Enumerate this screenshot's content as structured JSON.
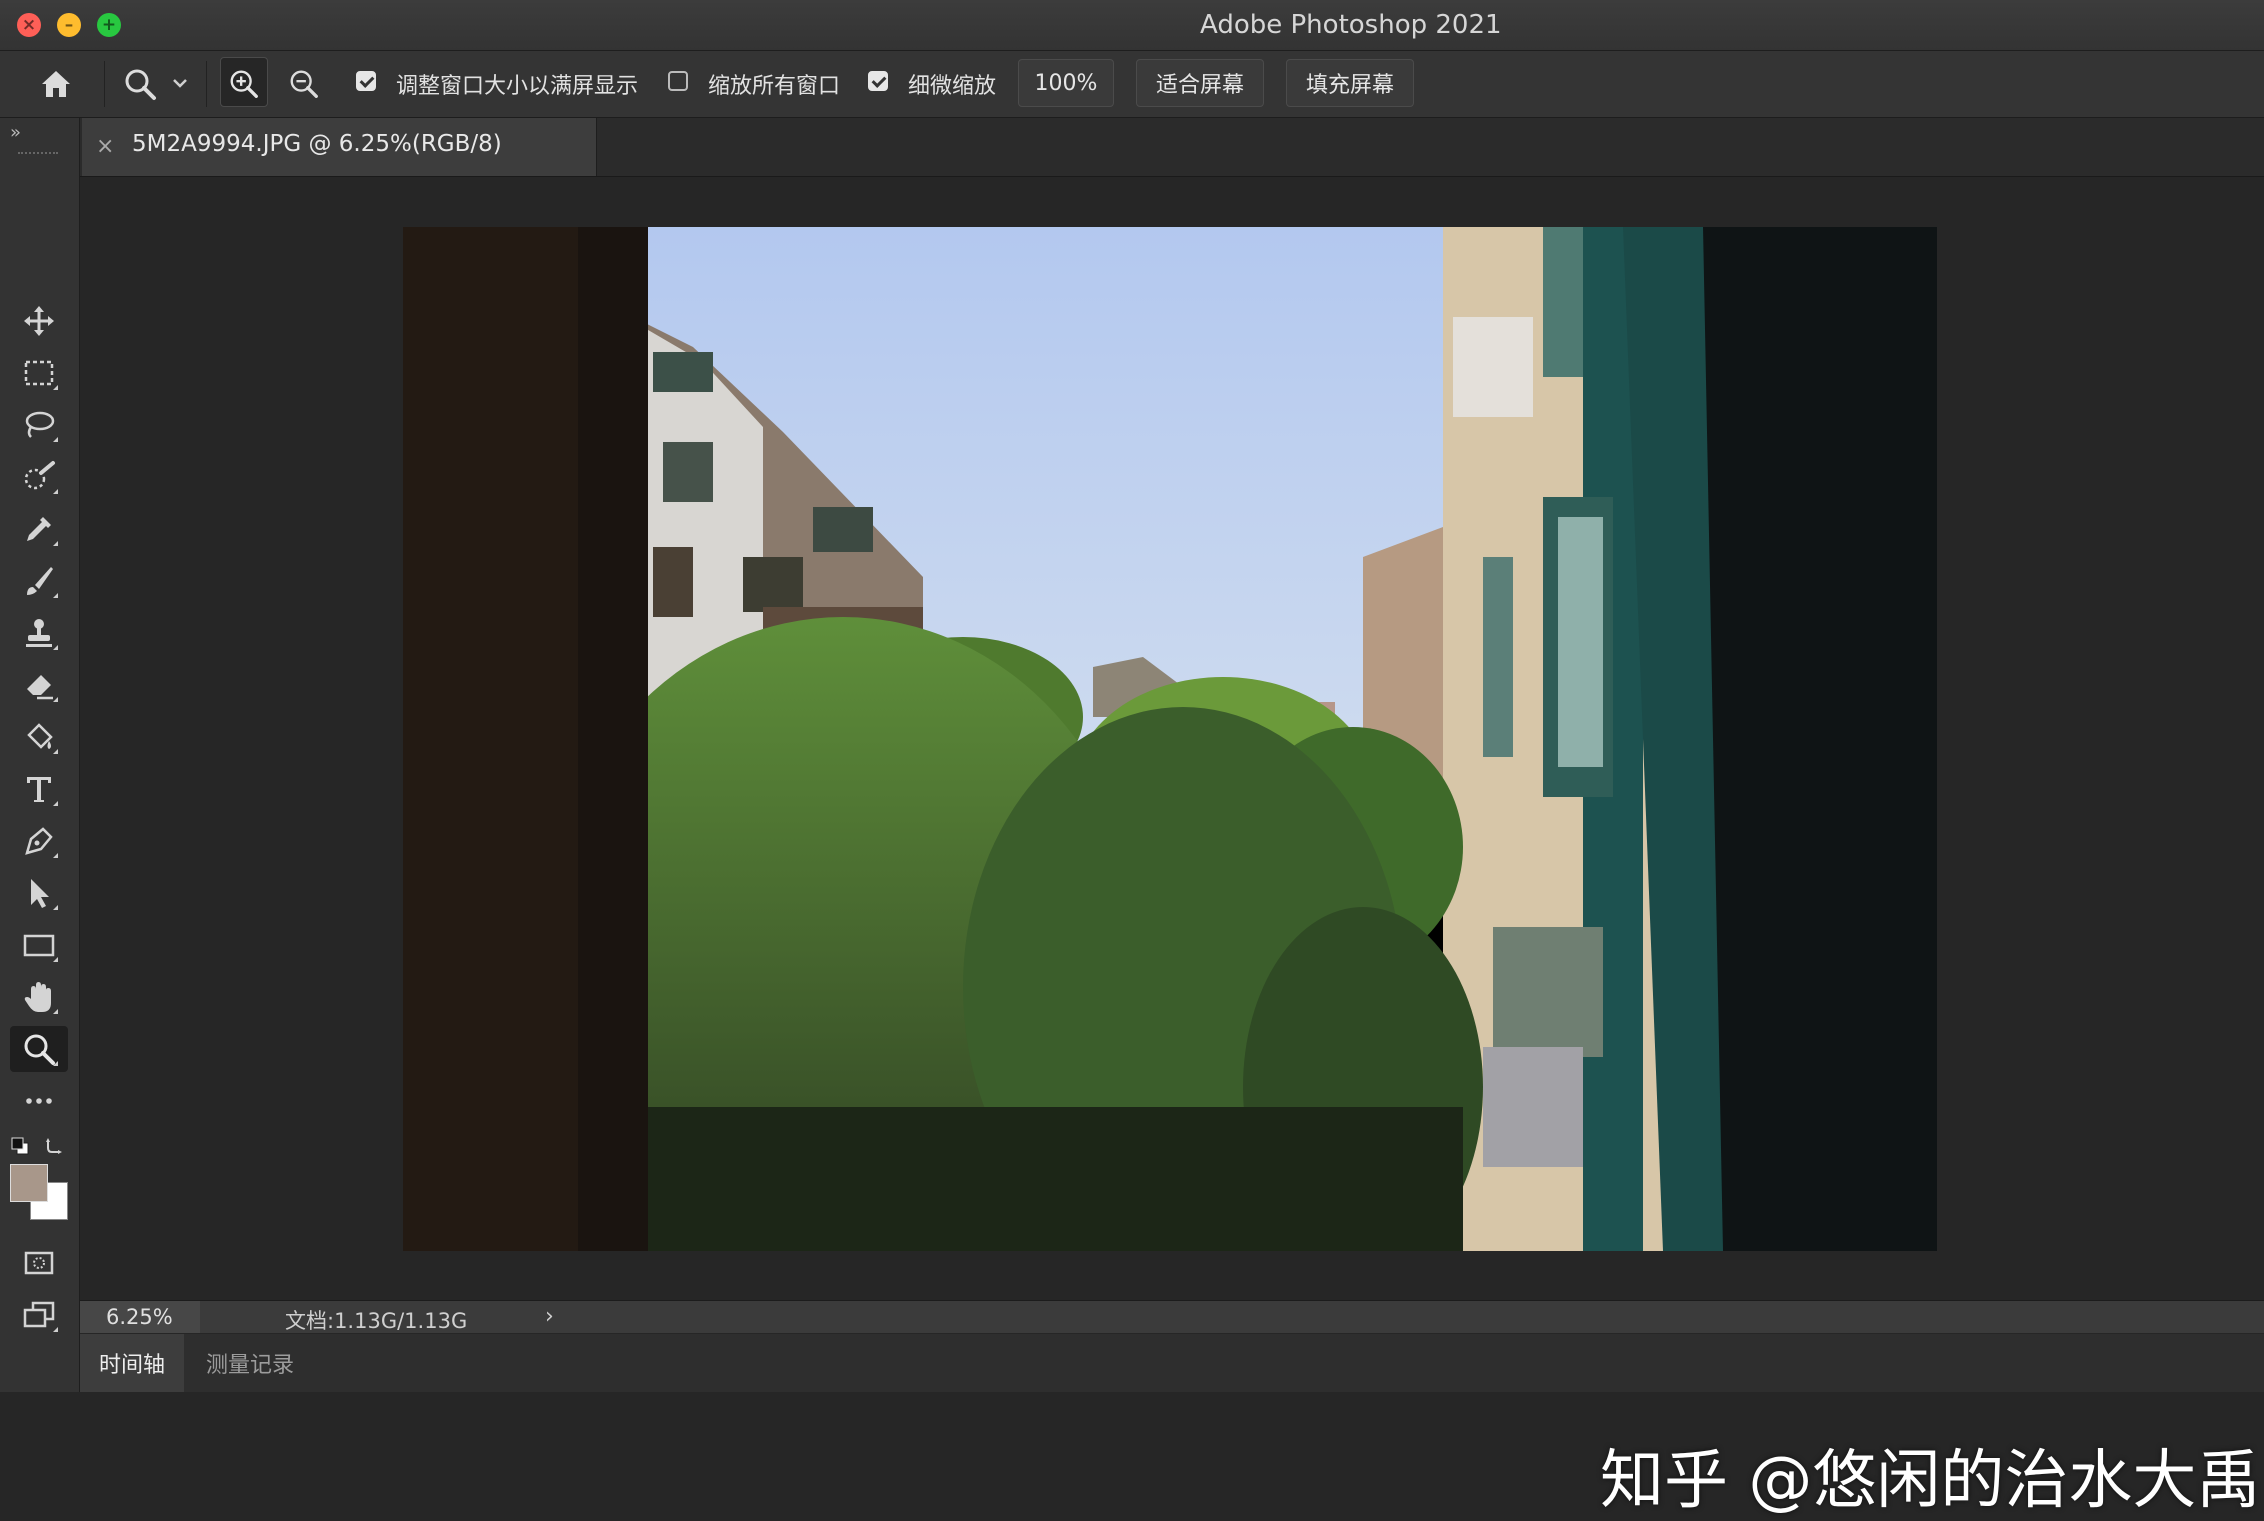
{
  "window": {
    "title": "Adobe Photoshop 2021",
    "traffic_lights": [
      "close",
      "minimize",
      "maximize"
    ],
    "colors": {
      "close": "#fe5f57",
      "minimize": "#febc2e",
      "maximize": "#28c840"
    }
  },
  "options_bar": {
    "icons": [
      "home-icon",
      "zoom-tool-icon",
      "chevron-down-icon",
      "zoom-in-icon",
      "zoom-out-icon"
    ],
    "resize_windows": {
      "label": "调整窗口大小以满屏显示",
      "checked": true
    },
    "zoom_all_windows": {
      "label": "缩放所有窗口",
      "checked": false
    },
    "scrubby_zoom": {
      "label": "细微缩放",
      "checked": true
    },
    "zoom_100_label": "100%",
    "fit_screen_label": "适合屏幕",
    "fill_screen_label": "填充屏幕"
  },
  "tools": {
    "items": [
      "move",
      "rectangular-marquee",
      "lasso",
      "quick-selection",
      "eyedropper",
      "brush",
      "clone-stamp",
      "eraser",
      "paint-bucket",
      "type",
      "pen",
      "path-selection",
      "rectangle",
      "hand",
      "zoom",
      "more"
    ],
    "active": "zoom",
    "foreground_color": "#a8978a",
    "background_color": "#ffffff"
  },
  "document": {
    "tab_title": "5M2A9994.JPG @ 6.25%(RGB/8)"
  },
  "status_bar": {
    "zoom": "6.25%",
    "doc_info": "文档:1.13G/1.13G",
    "chevron": "›"
  },
  "bottom_panels": {
    "tabs": [
      "时间轴",
      "测量记录"
    ],
    "active_index": 0
  },
  "watermark": "知乎 @悠闲的治水大禹"
}
